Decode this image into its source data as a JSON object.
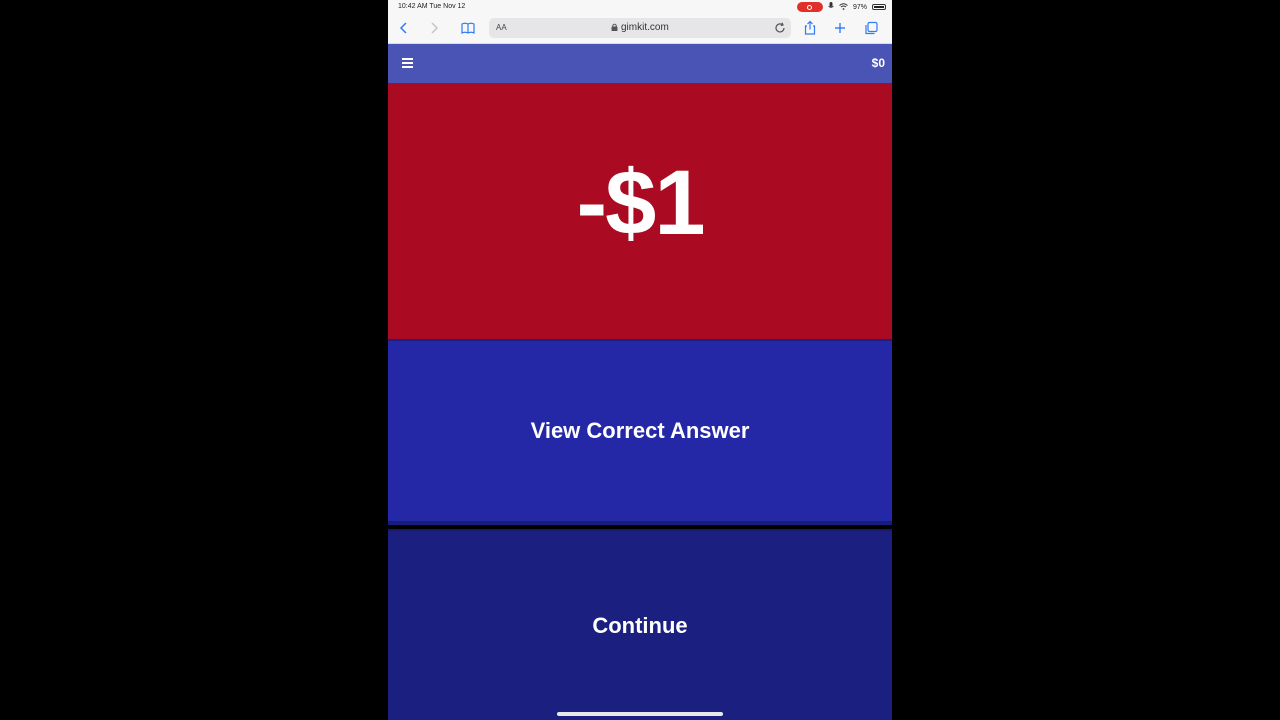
{
  "status_bar": {
    "time": "10:42 AM  Tue Nov 12",
    "battery": "97%",
    "battery_level": 0.97
  },
  "browser": {
    "text_size_label": "AA",
    "url": "gimkit.com"
  },
  "header": {
    "balance": "$0"
  },
  "result": {
    "amount": "-$1",
    "color": "#ab0b22"
  },
  "actions": {
    "view_answer_label": "View Correct Answer",
    "continue_label": "Continue"
  },
  "colors": {
    "header": "#4a54b5",
    "view_answer": "#2428a7",
    "continue": "#1b1f80",
    "browser_accent": "#2f7cf6"
  }
}
